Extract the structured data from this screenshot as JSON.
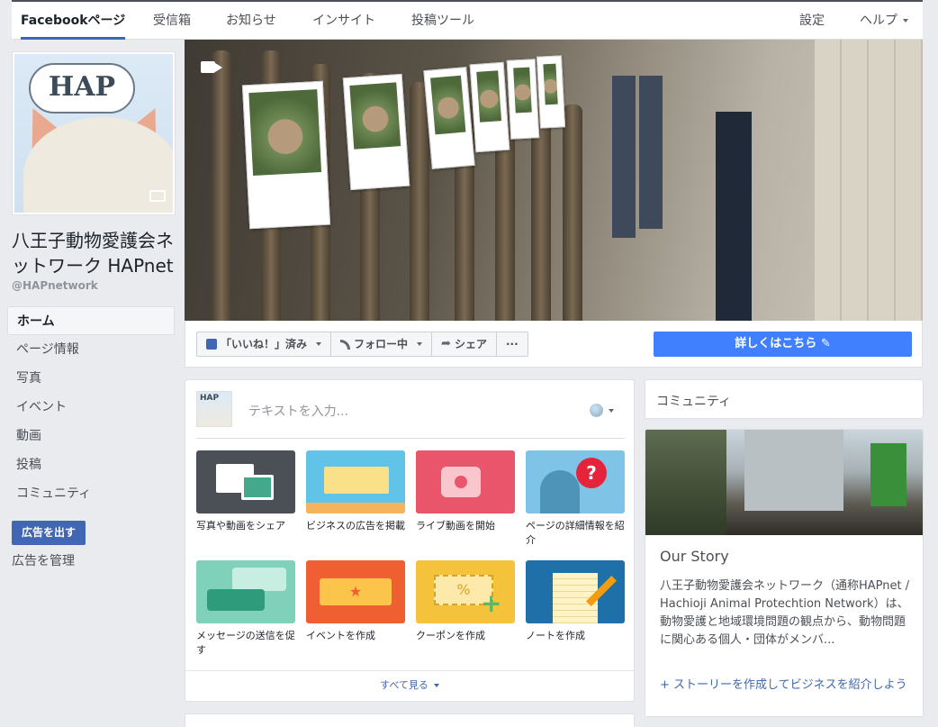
{
  "topbar": {
    "tabs": [
      {
        "label": "Facebookページ",
        "active": true
      },
      {
        "label": "受信箱"
      },
      {
        "label": "お知らせ"
      },
      {
        "label": "インサイト"
      },
      {
        "label": "投稿ツール"
      }
    ],
    "settings": "設定",
    "help": "ヘルプ"
  },
  "profile": {
    "logo_text": "HAP",
    "page_name": "八王子動物愛護会ネットワーク HAPnet",
    "handle": "@HAPnetwork"
  },
  "nav": {
    "items": [
      "ホーム",
      "ページ情報",
      "写真",
      "イベント",
      "動画",
      "投稿",
      "コミュニティ"
    ]
  },
  "ads": {
    "promote": "広告を出す",
    "manage": "広告を管理"
  },
  "actions": {
    "like": "「いいね！」済み",
    "follow": "フォロー中",
    "share": "シェア",
    "more": "···",
    "learn_more": "詳しくはこちら"
  },
  "composer": {
    "avatar_text": "HAP",
    "placeholder": "テキストを入力...",
    "tiles": [
      {
        "label": "写真や動画をシェア",
        "color": "#4b4f56"
      },
      {
        "label": "ビジネスの広告を掲載",
        "color": "#61c3e8"
      },
      {
        "label": "ライブ動画を開始",
        "color": "#e9566b"
      },
      {
        "label": "ページの詳細情報を紹介",
        "color": "#7fc3e6"
      },
      {
        "label": "メッセージの送信を促す",
        "color": "#7fd1b9"
      },
      {
        "label": "イベントを作成",
        "color": "#f05f32"
      },
      {
        "label": "クーポンを作成",
        "color": "#f5c33b"
      },
      {
        "label": "ノートを作成",
        "color": "#1f6fa8"
      }
    ],
    "see_all": "すべて見る"
  },
  "right": {
    "community_title": "コミュニティ",
    "story_title": "Our Story",
    "story_body": "八王子動物愛護会ネットワーク（通称HAPnet / Hachioji Animal Protechtion Network）は、動物愛護と地域環境問題の観点から、動物問題に関心ある個人・団体がメンバ...",
    "story_cta": "+ ストーリーを作成してビジネスを紹介しよう"
  }
}
